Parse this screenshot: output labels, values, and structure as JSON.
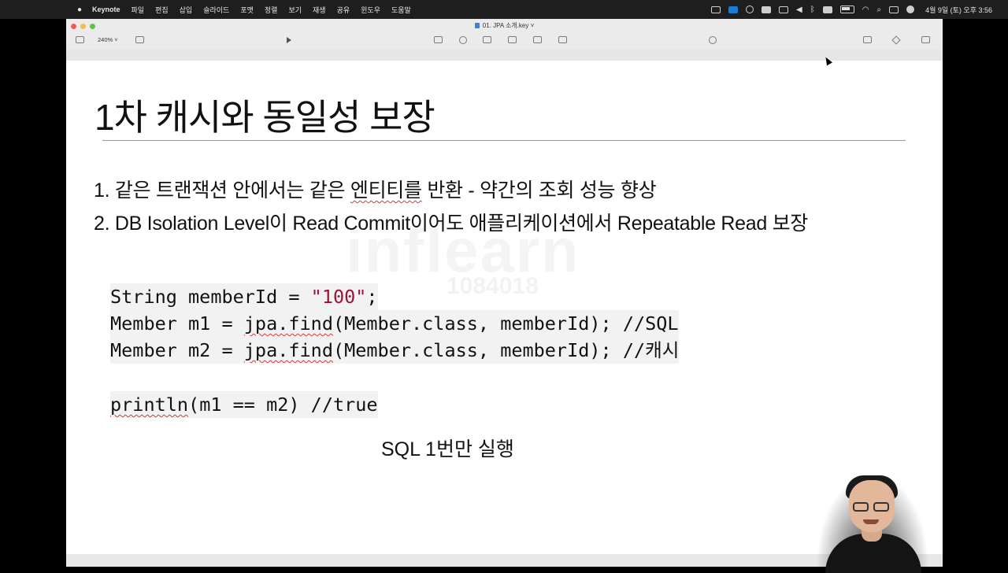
{
  "menubar": {
    "app_name": "Keynote",
    "items": [
      "파일",
      "편집",
      "삽입",
      "슬라이드",
      "포맷",
      "정렬",
      "보기",
      "재생",
      "공유",
      "윈도우",
      "도움말"
    ],
    "clock": "4월 9일 (토) 오후 3:56"
  },
  "window": {
    "doc_title": "01. JPA 소개.key",
    "zoom": "240%"
  },
  "slide": {
    "title": "1차 캐시와 동일성 보장",
    "bullet1_pre": "1. 같은 트랜잭션 안에서는 같은 ",
    "bullet1_squiggle": "엔티티를",
    "bullet1_post": " 반환 - 약간의 조회 성능 향상",
    "bullet2": "2. DB Isolation Level이 Read Commit이어도 애플리케이션에서 Repeatable Read 보장",
    "code": {
      "line1_pre": "String memberId = ",
      "line1_str": "\"100\"",
      "line1_post": ";",
      "line2_pre": "Member m1 = ",
      "line2_fn": "jpa.find",
      "line2_post": "(Member.class, memberId); //SQL",
      "line3_pre": "Member m2 = ",
      "line3_fn": "jpa.find",
      "line3_post": "(Member.class, memberId); //캐시",
      "line4_fn": "println",
      "line4_post": "(m1 == m2) //true"
    },
    "caption": "SQL 1번만 실행",
    "watermark": "inflearn",
    "watermark_id": "1084018"
  },
  "colors": {
    "string_literal": "#a0123a",
    "squiggle": "#d23b3b",
    "close": "#ee5c55",
    "minimize": "#f4be4f",
    "maximize": "#5ec14c"
  }
}
